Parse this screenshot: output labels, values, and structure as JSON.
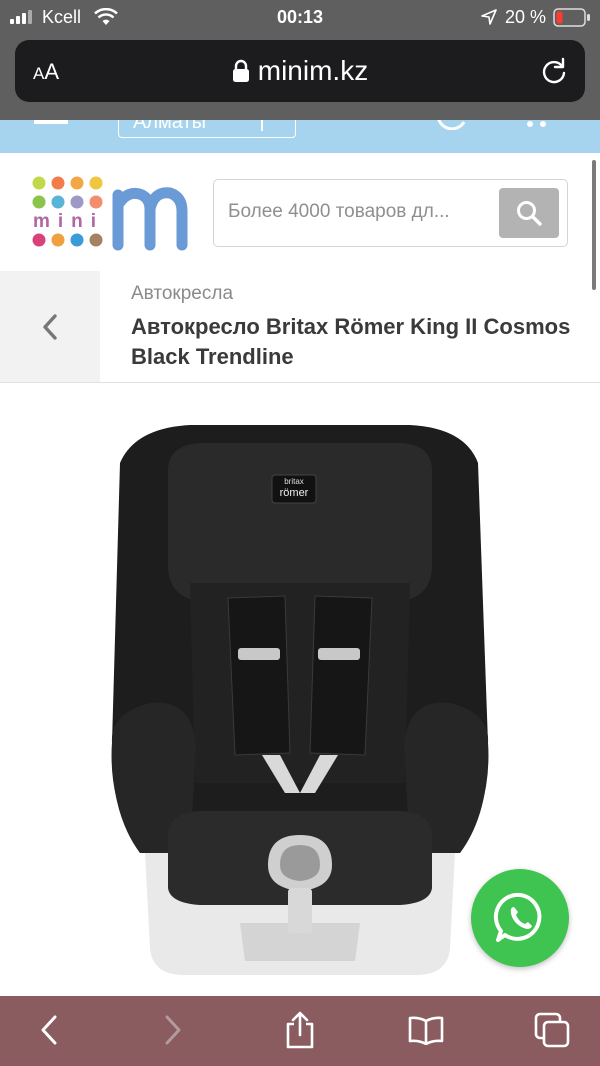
{
  "status_bar": {
    "carrier": "Kcell",
    "time": "00:13",
    "battery": "20 %",
    "icons": [
      "signal-icon",
      "wifi-icon",
      "location-arrow-icon",
      "battery-icon"
    ]
  },
  "browser": {
    "text_size_label": "AA",
    "url": "minim.kz",
    "icons": [
      "lock-icon",
      "reload-icon"
    ]
  },
  "scrolled_header": {
    "city_label": "Алматы"
  },
  "header": {
    "logo_text": "mini",
    "search_placeholder": "Более 4000 товаров дл...",
    "icons": [
      "search-icon"
    ]
  },
  "breadcrumb": {
    "category": "Автокресла",
    "title": "Автокресло Britax Römer King II Cosmos Black Trendline"
  },
  "product_image": {
    "brand_top": "britax",
    "brand_bottom": "römer"
  },
  "floating": {
    "icon": "whatsapp-icon",
    "color": "#3fc351"
  },
  "toolbar": {
    "icons": [
      "back-icon",
      "forward-icon",
      "share-icon",
      "bookmarks-icon",
      "tabs-icon"
    ]
  },
  "colors": {
    "accent_blue": "#a6d4ee",
    "toolbar": "#8a5b5f",
    "status": "#5f5f5f"
  }
}
